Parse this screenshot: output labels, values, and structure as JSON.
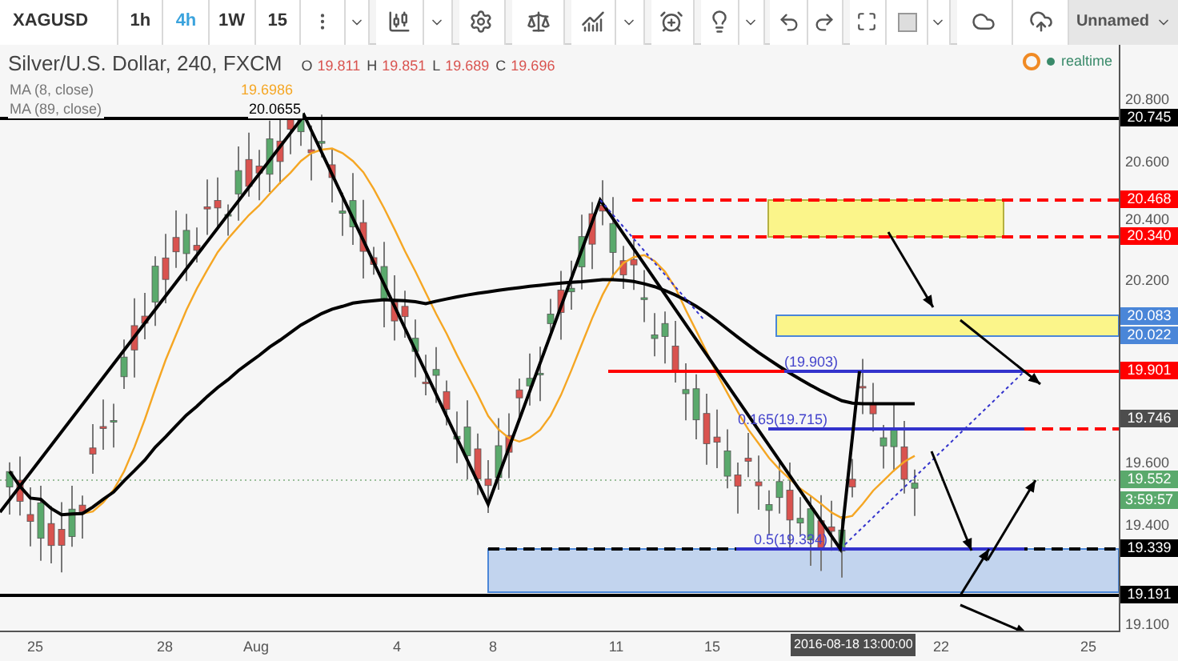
{
  "toolbar": {
    "symbol": "XAGUSD",
    "intervals": [
      {
        "label": "1h",
        "selected": false
      },
      {
        "label": "4h",
        "selected": true
      },
      {
        "label": "1W",
        "selected": false
      },
      {
        "label": "15",
        "selected": false
      }
    ],
    "layout_name": "Unnamed"
  },
  "legend": {
    "title": "Silver/U.S. Dollar, 240, FXCM",
    "ohlc": [
      {
        "key": "O",
        "value": "19.811"
      },
      {
        "key": "H",
        "value": "19.851"
      },
      {
        "key": "L",
        "value": "19.689"
      },
      {
        "key": "C",
        "value": "19.696"
      }
    ],
    "indicators": [
      {
        "name": "MA (8, close)",
        "value": "19.6986",
        "color": "#f5a623"
      },
      {
        "name": "MA (89, close)",
        "value": "20.0655",
        "color": "#000000"
      }
    ]
  },
  "status": "realtime",
  "fib_labels": [
    "(19.903)",
    "0.165(19.715)",
    "0.5(19.334)"
  ],
  "price_ticks": [
    "20.800",
    "20.600",
    "20.400",
    "20.200",
    "19.600",
    "19.400",
    "19.100"
  ],
  "price_tags": [
    {
      "label": "20.745",
      "color": "#000000"
    },
    {
      "label": "20.468",
      "color": "#ff0000"
    },
    {
      "label": "20.340",
      "color": "#ff0000"
    },
    {
      "label": "20.083",
      "color": "#4a86d8"
    },
    {
      "label": "20.022",
      "color": "#4a86d8"
    },
    {
      "label": "19.901",
      "color": "#ff0000"
    },
    {
      "label": "19.746",
      "color": "#4d4d4d"
    },
    {
      "label": "19.552",
      "color": "#5aa96c"
    },
    {
      "label": "3:59:57",
      "color": "#5aa96c"
    },
    {
      "label": "19.339",
      "color": "#000000"
    },
    {
      "label": "19.191",
      "color": "#000000"
    }
  ],
  "time_ticks": [
    "25",
    "28",
    "Aug",
    "4",
    "8",
    "11",
    "15",
    "22",
    "25"
  ],
  "crosshair_time": "2016-08-18 13:00:00"
}
